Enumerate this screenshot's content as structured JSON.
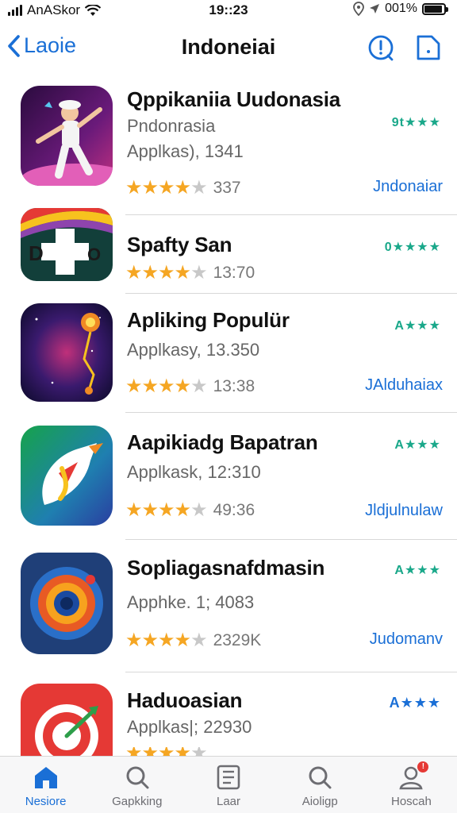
{
  "status_bar": {
    "carrier": "AnASkor",
    "time": "19::23",
    "battery_text": "001%",
    "battery_level": 0.9
  },
  "nav": {
    "back_label": "Laoie",
    "title": "Indoneiai"
  },
  "apps": [
    {
      "name": "Qppikaniia Uudonasia",
      "subtitle": "Pndonrasia",
      "subtitle2": "Applkas), 1341",
      "rating": 4,
      "rating_count": "337",
      "badge": "9t★★★",
      "badge_color": "#1aa88a",
      "link": "Jndonaiar"
    },
    {
      "name": "Spafty San",
      "subtitle": "",
      "subtitle2": "",
      "rating": 4,
      "rating_count": "13:70",
      "badge": "0★★★★",
      "badge_color": "#1aa88a",
      "link": ""
    },
    {
      "name": "Apliking Populür",
      "subtitle": "",
      "subtitle2": "Applkasy, 13.350",
      "rating": 4,
      "rating_count": "13:38",
      "badge": "A★★★",
      "badge_color": "#1aa88a",
      "link": "JAlduhaiax"
    },
    {
      "name": "Aapikiadg Bapatran",
      "subtitle": "",
      "subtitle2": "Applkask, 12:310",
      "rating": 4,
      "rating_count": "49:36",
      "badge": "A★★★",
      "badge_color": "#1aa88a",
      "link": "Jldjulnulaw"
    },
    {
      "name": "Sopliagasnafdmasin",
      "subtitle": "",
      "subtitle2": "Apphke. 1; 4083",
      "rating": 4,
      "rating_count": "2329K",
      "badge": "A★★★",
      "badge_color": "#1aa88a",
      "link": "Judomanv"
    },
    {
      "name": "Haduoasian",
      "subtitle": "",
      "subtitle2": "Applkas|; 22930",
      "rating": 4,
      "rating_count": "",
      "badge": "A★★★",
      "badge_color": "#1a6fd6",
      "link": ""
    }
  ],
  "tabs": [
    {
      "label": "Nesiore",
      "icon": "home-icon",
      "active": true
    },
    {
      "label": "Gapkking",
      "icon": "search-icon",
      "active": false
    },
    {
      "label": "Laar",
      "icon": "list-icon",
      "active": false
    },
    {
      "label": "Aioligp",
      "icon": "search-icon",
      "active": false
    },
    {
      "label": "Hoscah",
      "icon": "profile-icon",
      "active": false
    }
  ],
  "colors": {
    "accent": "#1a6fd6",
    "star": "#f5a623",
    "badge_green": "#1aa88a"
  }
}
